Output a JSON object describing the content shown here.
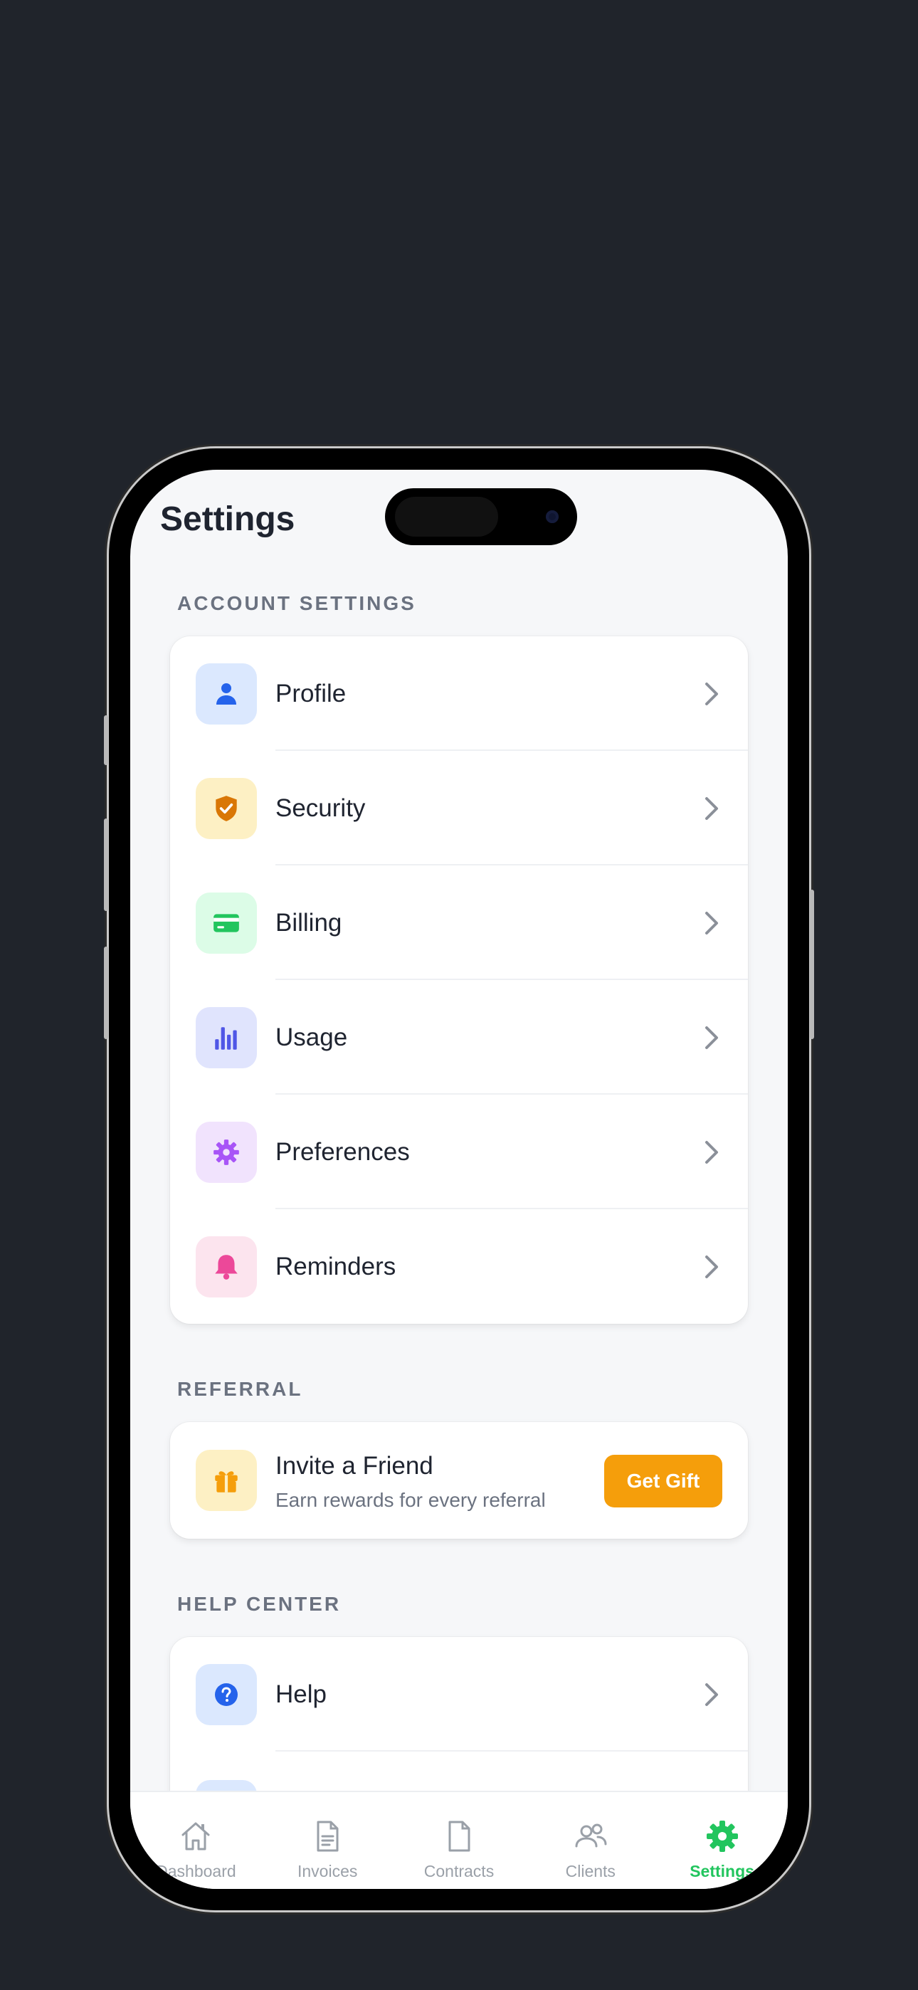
{
  "header": {
    "title": "Settings"
  },
  "sections": {
    "account": {
      "label": "ACCOUNT SETTINGS",
      "items": [
        {
          "label": "Profile",
          "icon": "person-icon",
          "bg": "#dbe8fe",
          "color": "#2563eb"
        },
        {
          "label": "Security",
          "icon": "shield-icon",
          "bg": "#fdf0c4",
          "color": "#d97706"
        },
        {
          "label": "Billing",
          "icon": "credit-card-icon",
          "bg": "#dcfce7",
          "color": "#22c55e"
        },
        {
          "label": "Usage",
          "icon": "bar-chart-icon",
          "bg": "#e0e4fd",
          "color": "#4f56e6"
        },
        {
          "label": "Preferences",
          "icon": "gear-icon",
          "bg": "#f1e3fd",
          "color": "#a855f7"
        },
        {
          "label": "Reminders",
          "icon": "bell-icon",
          "bg": "#fce4ee",
          "color": "#ec4899"
        }
      ]
    },
    "referral": {
      "label": "REFERRAL",
      "title": "Invite a Friend",
      "subtitle": "Earn rewards for every referral",
      "button": "Get Gift",
      "icon": "gift-icon",
      "bg": "#fdf0c4",
      "color": "#f59e0b"
    },
    "help": {
      "label": "HELP CENTER",
      "items": [
        {
          "label": "Help",
          "icon": "help-circle-icon",
          "bg": "#dbe8fe",
          "color": "#2563eb"
        }
      ]
    }
  },
  "tabbar": {
    "tabs": [
      {
        "label": "Dashboard",
        "icon": "home-icon"
      },
      {
        "label": "Invoices",
        "icon": "document-icon"
      },
      {
        "label": "Contracts",
        "icon": "file-icon"
      },
      {
        "label": "Clients",
        "icon": "users-icon"
      },
      {
        "label": "Settings",
        "icon": "gear-icon",
        "active": true
      }
    ],
    "active_color": "#22c55e",
    "inactive_color": "#9aa0a8"
  }
}
